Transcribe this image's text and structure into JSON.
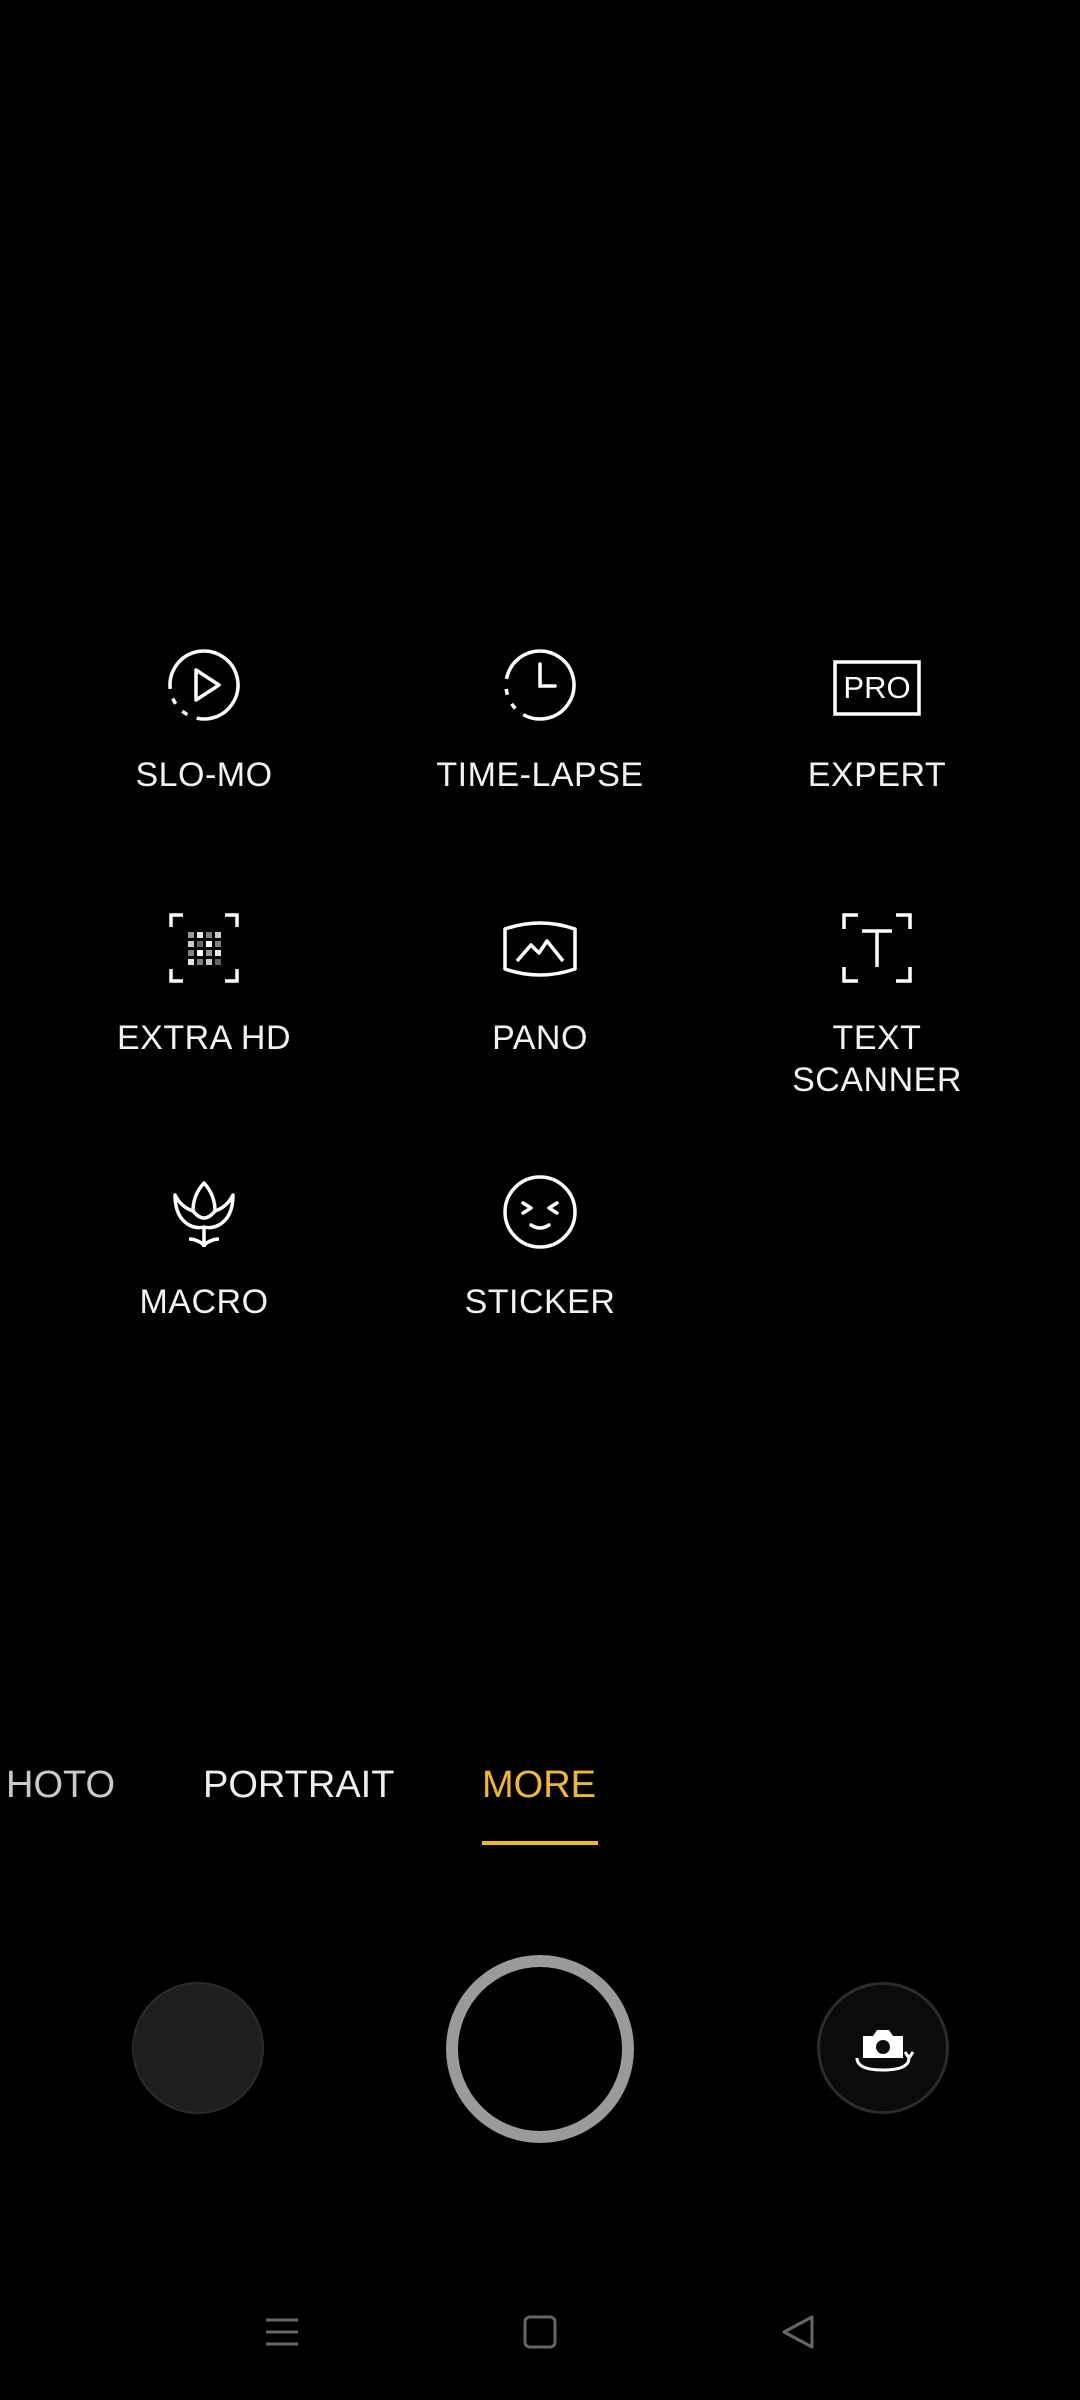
{
  "modes": [
    {
      "id": "slo-mo",
      "label": "SLO-MO",
      "icon": "slo-mo-icon"
    },
    {
      "id": "time-lapse",
      "label": "TIME-LAPSE",
      "icon": "time-lapse-icon"
    },
    {
      "id": "expert",
      "label": "EXPERT",
      "icon": "pro-icon",
      "icon_text": "PRO"
    },
    {
      "id": "extra-hd",
      "label": "EXTRA HD",
      "icon": "extra-hd-icon"
    },
    {
      "id": "pano",
      "label": "PANO",
      "icon": "pano-icon"
    },
    {
      "id": "text-scanner",
      "label": "TEXT\nSCANNER",
      "icon": "text-scanner-icon"
    },
    {
      "id": "macro",
      "label": "MACRO",
      "icon": "macro-flower-icon"
    },
    {
      "id": "sticker",
      "label": "STICKER",
      "icon": "sticker-face-icon"
    }
  ],
  "mode_tabs": [
    {
      "label": "HOTO",
      "active": false
    },
    {
      "label": "PORTRAIT",
      "active": false
    },
    {
      "label": "MORE",
      "active": true
    }
  ],
  "colors": {
    "accent": "#f2b731",
    "shutter_ring": "#9a9a9a",
    "background": "#000000"
  },
  "controls": {
    "gallery": "gallery-thumbnail",
    "shutter": "shutter-button",
    "flip": "switch-camera-icon"
  },
  "navbar": {
    "menu": "menu-icon",
    "home": "home-square-icon",
    "back": "back-triangle-icon"
  }
}
